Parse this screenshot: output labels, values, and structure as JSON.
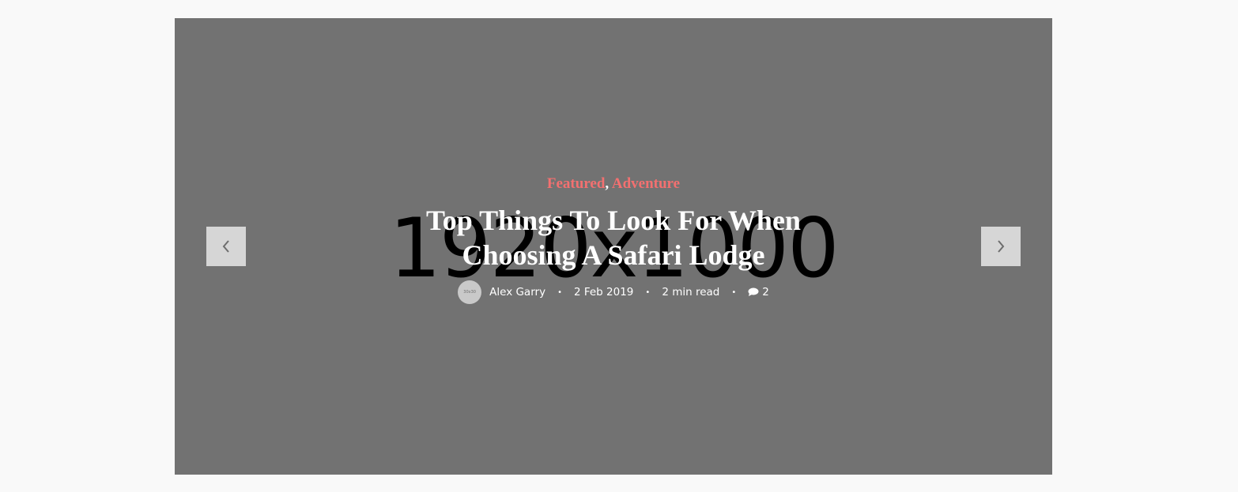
{
  "slider": {
    "placeholder_text": "1920x1000",
    "prev_icon": "chevron-left-icon",
    "next_icon": "chevron-right-icon",
    "background_color": "#727272",
    "arrow_background": "#d6d6d6"
  },
  "post": {
    "categories": [
      "Featured",
      "Adventure"
    ],
    "category_separator": ",",
    "category_color": "#f37070",
    "title": "Top Things To Look For When Choosing A Safari Lodge",
    "author": {
      "avatar_text": "30x30",
      "name": "Alex Garry"
    },
    "date": "2 Feb 2019",
    "read_time": "2 min read",
    "comments_icon": "comment-icon",
    "comments_count": "2",
    "meta_separator": "•"
  }
}
